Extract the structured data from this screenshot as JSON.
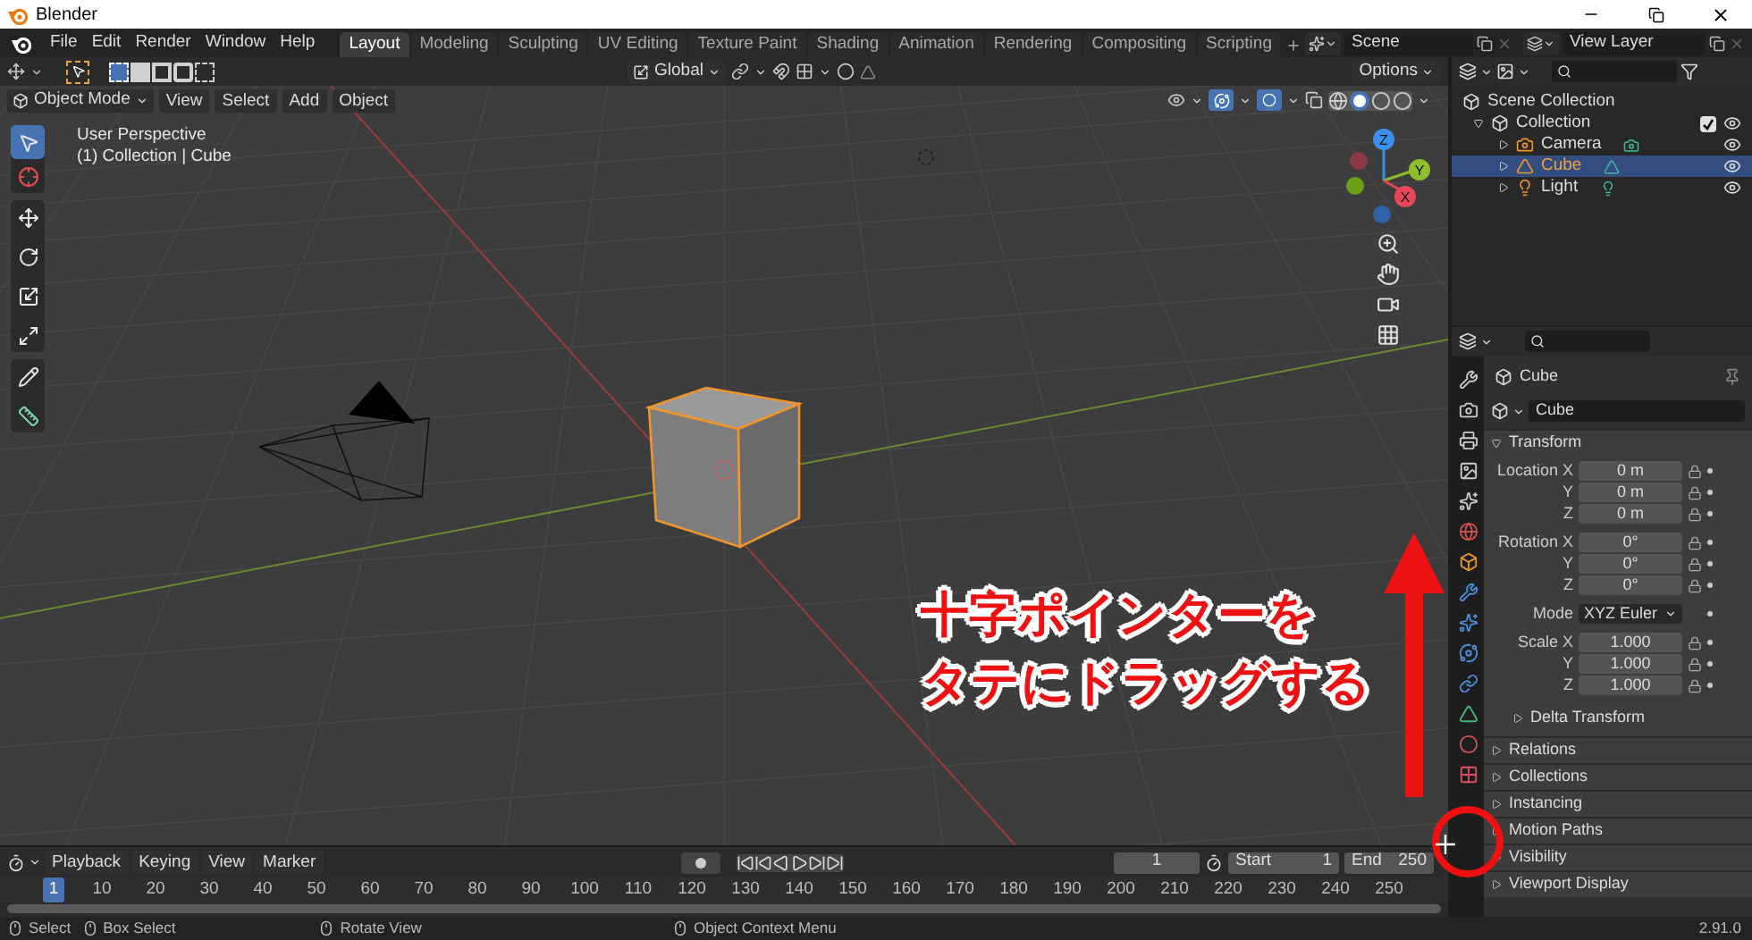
{
  "window": {
    "title": "Blender"
  },
  "menu": [
    "File",
    "Edit",
    "Render",
    "Window",
    "Help"
  ],
  "workspaces": [
    {
      "label": "Layout",
      "selected": true
    },
    {
      "label": "Modeling",
      "selected": false
    },
    {
      "label": "Sculpting",
      "selected": false
    },
    {
      "label": "UV Editing",
      "selected": false
    },
    {
      "label": "Texture Paint",
      "selected": false
    },
    {
      "label": "Shading",
      "selected": false
    },
    {
      "label": "Animation",
      "selected": false
    },
    {
      "label": "Rendering",
      "selected": false
    },
    {
      "label": "Compositing",
      "selected": false
    },
    {
      "label": "Scripting",
      "selected": false
    }
  ],
  "scene": "Scene",
  "view_layer": "View Layer",
  "viewport": {
    "orientation": "Global",
    "options": "Options",
    "mode": "Object Mode",
    "menus": [
      "View",
      "Select",
      "Add",
      "Object"
    ],
    "overlay_text": [
      "User Perspective",
      "(1) Collection | Cube"
    ],
    "gizmo_axes": [
      "Z",
      "Y",
      "X"
    ]
  },
  "outliner": {
    "root": "Scene Collection",
    "items": [
      {
        "label": "Collection",
        "checked": true,
        "expanded": true,
        "children": [
          {
            "label": "Camera",
            "kind": "camera",
            "selected": false
          },
          {
            "label": "Cube",
            "kind": "mesh",
            "selected": true
          },
          {
            "label": "Light",
            "kind": "light",
            "selected": false
          }
        ]
      }
    ]
  },
  "properties": {
    "object_name": "Cube",
    "data_name": "Cube",
    "transform": {
      "title": "Transform",
      "expanded": true,
      "groups": [
        {
          "rows": [
            {
              "kind": "field",
              "label": "Location X",
              "value": "0 m"
            },
            {
              "kind": "field",
              "label": "Y",
              "value": "0 m"
            },
            {
              "kind": "field",
              "label": "Z",
              "value": "0 m"
            }
          ]
        },
        {
          "rows": [
            {
              "kind": "field",
              "label": "Rotation X",
              "value": "0°"
            },
            {
              "kind": "field",
              "label": "Y",
              "value": "0°"
            },
            {
              "kind": "field",
              "label": "Z",
              "value": "0°"
            }
          ]
        },
        {
          "rows": [
            {
              "kind": "dropdown",
              "label": "Mode",
              "value": "XYZ Euler"
            }
          ]
        },
        {
          "rows": [
            {
              "kind": "field",
              "label": "Scale X",
              "value": "1.000"
            },
            {
              "kind": "field",
              "label": "Y",
              "value": "1.000"
            },
            {
              "kind": "field",
              "label": "Z",
              "value": "1.000"
            }
          ]
        }
      ],
      "subpanel": {
        "title": "Delta Transform",
        "expanded": false
      }
    },
    "panels": [
      {
        "title": "Relations",
        "expanded": false
      },
      {
        "title": "Collections",
        "expanded": false
      },
      {
        "title": "Instancing",
        "expanded": false
      },
      {
        "title": "Motion Paths",
        "expanded": false
      },
      {
        "title": "Visibility",
        "expanded": false
      },
      {
        "title": "Viewport Display",
        "expanded": false
      }
    ]
  },
  "timeline": {
    "menus": [
      "Playback",
      "Keying",
      "View",
      "Marker"
    ],
    "current_frame": "1",
    "start_label": "Start",
    "start": "1",
    "end_label": "End",
    "end": "250",
    "ticks": [
      {
        "label": "1",
        "selected": true
      },
      {
        "label": "10",
        "selected": false
      },
      {
        "label": "20",
        "selected": false
      },
      {
        "label": "30",
        "selected": false
      },
      {
        "label": "40",
        "selected": false
      },
      {
        "label": "50",
        "selected": false
      },
      {
        "label": "60",
        "selected": false
      },
      {
        "label": "70",
        "selected": false
      },
      {
        "label": "80",
        "selected": false
      },
      {
        "label": "90",
        "selected": false
      },
      {
        "label": "100",
        "selected": false
      },
      {
        "label": "110",
        "selected": false
      },
      {
        "label": "120",
        "selected": false
      },
      {
        "label": "130",
        "selected": false
      },
      {
        "label": "140",
        "selected": false
      },
      {
        "label": "150",
        "selected": false
      },
      {
        "label": "160",
        "selected": false
      },
      {
        "label": "170",
        "selected": false
      },
      {
        "label": "180",
        "selected": false
      },
      {
        "label": "190",
        "selected": false
      },
      {
        "label": "200",
        "selected": false
      },
      {
        "label": "210",
        "selected": false
      },
      {
        "label": "220",
        "selected": false
      },
      {
        "label": "230",
        "selected": false
      },
      {
        "label": "240",
        "selected": false
      },
      {
        "label": "250",
        "selected": false
      }
    ]
  },
  "status_bar": {
    "hints": [
      "Select",
      "Box Select",
      "Rotate View",
      "Object Context Menu"
    ],
    "version": "2.91.0"
  },
  "annotation": {
    "lines": [
      "十字ポインターを",
      "タテにドラッグする"
    ]
  }
}
